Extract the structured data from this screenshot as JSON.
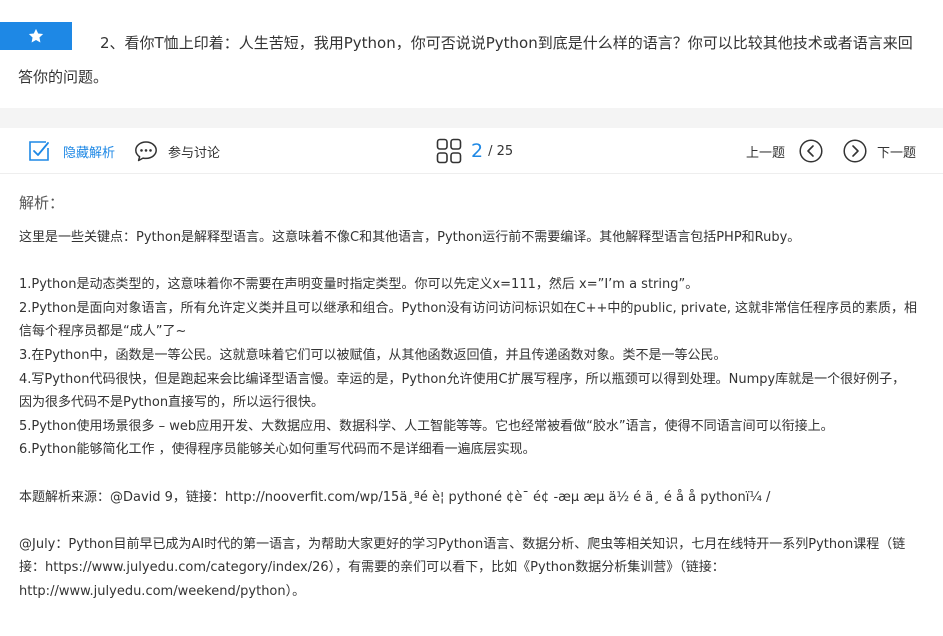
{
  "question": {
    "text": "2、看你T恤上印着：人生苦短，我用Python，你可否说说Python到底是什么样的语言？你可以比较其他技术或者语言来回答你的问题。"
  },
  "toolbar": {
    "hide_analysis": "隐藏解析",
    "discuss": "参与讨论",
    "current": "2",
    "total": "/ 25",
    "prev": "上一题",
    "next": "下一题"
  },
  "analysis": {
    "title": "解析：",
    "intro": "这里是一些关键点：Python是解释型语言。这意味着不像C和其他语言，Python运行前不需要编译。其他解释型语言包括PHP和Ruby。",
    "points": [
      "1.Python是动态类型的，这意味着你不需要在声明变量时指定类型。你可以先定义x=111，然后 x=”I’m a string”。",
      "2.Python是面向对象语言，所有允许定义类并且可以继承和组合。Python没有访问访问标识如在C++中的public, private, 这就非常信任程序员的素质，相信每个程序员都是“成人”了~",
      "3.在Python中，函数是一等公民。这就意味着它们可以被赋值，从其他函数返回值，并且传递函数对象。类不是一等公民。",
      "4.写Python代码很快，但是跑起来会比编译型语言慢。幸运的是，Python允许使用C扩展写程序，所以瓶颈可以得到处理。Numpy库就是一个很好例子，因为很多代码不是Python直接写的，所以运行很快。",
      "5.Python使用场景很多 – web应用开发、大数据应用、数据科学、人工智能等等。它也经常被看做“胶水”语言，使得不同语言间可以衔接上。",
      "6.Python能够简化工作 ，使得程序员能够关心如何重写代码而不是详细看一遍底层实现。"
    ],
    "source": "本题解析来源：@David 9，链接：http://nooverfit.com/wp/15ä¸ªé    è¦ pythoné ¢è¯ é¢ -æµ  æµ  ä½ é     ä¸ é   å   å    pythonï¼  /",
    "july": "@July：Python目前早已成为AI时代的第一语言，为帮助大家更好的学习Python语言、数据分析、爬虫等相关知识，七月在线特开一系列Python课程（链接：https://www.julyedu.com/category/index/26），有需要的亲们可以看下，比如《Python数据分析集训营》（链接：http://www.julyedu.com/weekend/python）。"
  },
  "colors": {
    "accent": "#1e88e5",
    "text": "#333333",
    "divider": "#f4f4f4"
  },
  "icons": {
    "star": "star-icon",
    "hide_analysis": "checkbox-icon",
    "discuss": "chat-bubble-icon",
    "pager": "grid-icon",
    "prev": "chevron-left-circle-icon",
    "next": "chevron-right-circle-icon"
  }
}
